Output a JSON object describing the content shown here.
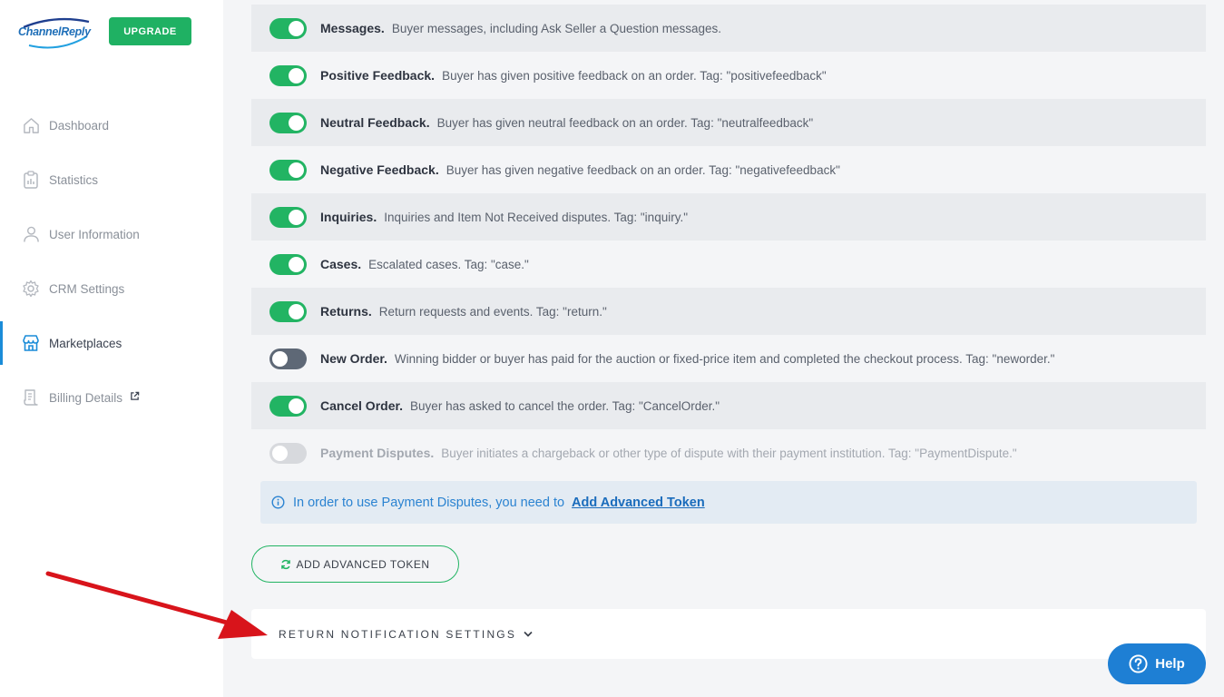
{
  "brand": {
    "logo_channel": "Channel",
    "logo_reply": "Reply",
    "upgrade_label": "UPGRADE"
  },
  "sidebar": {
    "items": [
      {
        "label": "Dashboard",
        "icon": "home-icon"
      },
      {
        "label": "Statistics",
        "icon": "clipboard-icon"
      },
      {
        "label": "User Information",
        "icon": "user-icon"
      },
      {
        "label": "CRM Settings",
        "icon": "gear-icon"
      },
      {
        "label": "Marketplaces",
        "icon": "store-icon",
        "active": true
      },
      {
        "label": "Billing Details",
        "icon": "receipt-icon",
        "external": true
      }
    ]
  },
  "notifications": [
    {
      "title": "Messages.",
      "desc": "Buyer messages, including Ask Seller a Question messages.",
      "state": "on"
    },
    {
      "title": "Positive Feedback.",
      "desc": "Buyer has given positive feedback on an order. Tag: \"positivefeedback\"",
      "state": "on"
    },
    {
      "title": "Neutral Feedback.",
      "desc": "Buyer has given neutral feedback on an order. Tag: \"neutralfeedback\"",
      "state": "on"
    },
    {
      "title": "Negative Feedback.",
      "desc": "Buyer has given negative feedback on an order. Tag: \"negativefeedback\"",
      "state": "on"
    },
    {
      "title": "Inquiries.",
      "desc": "Inquiries and Item Not Received disputes. Tag: \"inquiry.\"",
      "state": "on"
    },
    {
      "title": "Cases.",
      "desc": "Escalated cases. Tag: \"case.\"",
      "state": "on"
    },
    {
      "title": "Returns.",
      "desc": "Return requests and events. Tag: \"return.\"",
      "state": "on"
    },
    {
      "title": "New Order.",
      "desc": "Winning bidder or buyer has paid for the auction or fixed-price item and completed the checkout process. Tag: \"neworder.\"",
      "state": "off"
    },
    {
      "title": "Cancel Order.",
      "desc": "Buyer has asked to cancel the order. Tag: \"CancelOrder.\"",
      "state": "on"
    },
    {
      "title": "Payment Disputes.",
      "desc": "Buyer initiates a chargeback or other type of dispute with their payment institution. Tag: \"PaymentDispute.\"",
      "state": "disabled"
    }
  ],
  "info": {
    "text": "In order to use Payment Disputes, you need to",
    "link": "Add Advanced Token"
  },
  "add_token_button": "ADD ADVANCED TOKEN",
  "return_settings_label": "RETURN NOTIFICATION SETTINGS",
  "help_label": "Help",
  "colors": {
    "toggle_on": "#22b463",
    "toggle_off": "#5e6876",
    "accent": "#1e7fd4",
    "upgrade": "#1fb163"
  }
}
